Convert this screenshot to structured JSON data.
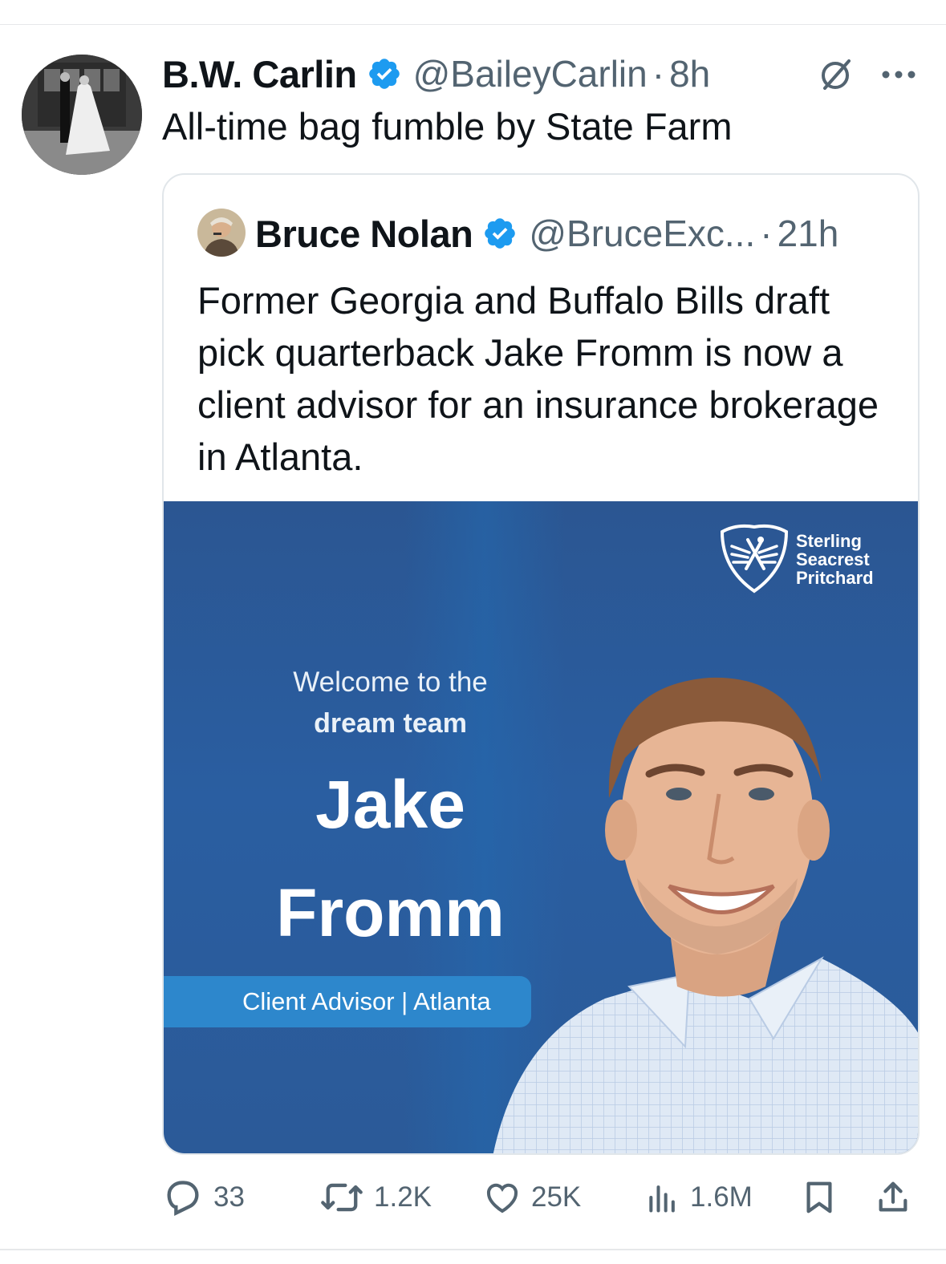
{
  "tweet": {
    "display_name": "B.W. Carlin",
    "handle": "@BaileyCarlin",
    "separator": "·",
    "time": "8h",
    "text": "All-time bag fumble by State Farm"
  },
  "quoted": {
    "display_name": "Bruce Nolan",
    "handle": "@BruceExc...",
    "separator": "·",
    "time": "21h",
    "text": "Former Georgia and Buffalo Bills draft pick quarterback Jake Fromm is now a client advisor for an insurance brokerage in Atlanta.",
    "image": {
      "logo_lines": [
        "Sterling",
        "Seacrest",
        "Pritchard"
      ],
      "welcome_line_1": "Welcome to the",
      "welcome_line_2": "dream team",
      "first_name": "Jake",
      "last_name": "Fromm",
      "role": "Client Advisor | Atlanta"
    }
  },
  "actions": {
    "replies": "33",
    "reposts": "1.2K",
    "likes": "25K",
    "views": "1.6M"
  },
  "colors": {
    "verified": "#1d9bf0",
    "muted_text": "#536471",
    "promo_bg": "#2a5ea1",
    "role_pill": "#2d87cc"
  },
  "icons": [
    "verified-badge-icon",
    "grok-icon",
    "more-icon",
    "reply-icon",
    "repost-icon",
    "like-icon",
    "views-icon",
    "bookmark-icon",
    "share-icon"
  ]
}
